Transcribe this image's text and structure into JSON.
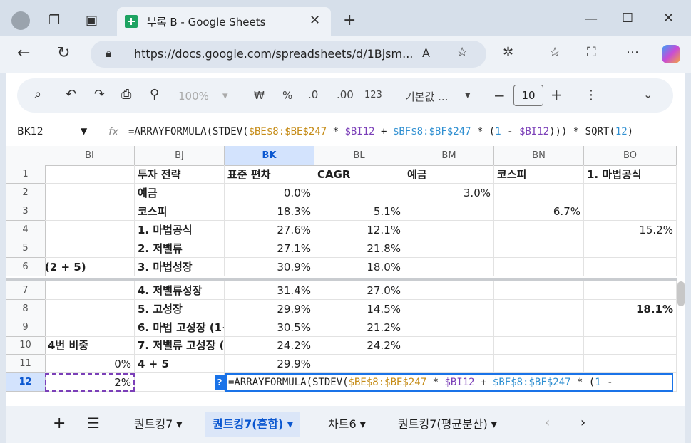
{
  "browser": {
    "tab_title": "부록 B - Google Sheets",
    "url": "https://docs.google.com/spreadsheets/d/1Bjsm..."
  },
  "toolbar": {
    "zoom": "100%",
    "currency": "₩",
    "percent": "%",
    "dec_decrease": ".0",
    "dec_increase": ".00",
    "format_123": "123",
    "font_name": "기본값 ...",
    "font_size": "10"
  },
  "formula_bar": {
    "name_box": "BK12",
    "fx": "fx",
    "formula_p1": "=ARRAYFORMULA(STDEV(",
    "formula_ref1": "$BE$8:$BE$247",
    "formula_p2": " * ",
    "formula_ref2": "$BI12",
    "formula_p3": " + ",
    "formula_ref3": "$BF$8:$BF$247",
    "formula_p4": " * (",
    "formula_num": "1",
    "formula_p5": " - ",
    "formula_ref4": "$BI12",
    "formula_p6": "))) * SQRT(",
    "formula_num2": "12",
    "formula_p7": ")"
  },
  "columns": [
    "BI",
    "BJ",
    "BK",
    "BL",
    "BM",
    "BN",
    "BO"
  ],
  "rows": [
    {
      "n": "1",
      "BI": "",
      "BJ": "투자 전략",
      "BK": "표준 편차",
      "BL": "CAGR",
      "BM": "예금",
      "BN": "코스피",
      "BO": "1. 마법공식"
    },
    {
      "n": "2",
      "BI": "",
      "BJ": "예금",
      "BK": "0.0%",
      "BL": "",
      "BM": "3.0%",
      "BN": "",
      "BO": ""
    },
    {
      "n": "3",
      "BI": "",
      "BJ": "코스피",
      "BK": "18.3%",
      "BL": "5.1%",
      "BM": "",
      "BN": "6.7%",
      "BO": ""
    },
    {
      "n": "4",
      "BI": "",
      "BJ": "1. 마법공식",
      "BK": "27.6%",
      "BL": "12.1%",
      "BM": "",
      "BN": "",
      "BO": "15.2%"
    },
    {
      "n": "5",
      "BI": "",
      "BJ": "2. 저밸류",
      "BK": "27.1%",
      "BL": "21.8%",
      "BM": "",
      "BN": "",
      "BO": ""
    },
    {
      "n": "6",
      "BI": "(2 + 5)",
      "BJ": "3. 마법성장",
      "BK": "30.9%",
      "BL": "18.0%",
      "BM": "",
      "BN": "",
      "BO": ""
    },
    {
      "n": "7",
      "BI": "",
      "BJ": "4. 저밸류성장",
      "BK": "31.4%",
      "BL": "27.0%",
      "BM": "",
      "BN": "",
      "BO": ""
    },
    {
      "n": "8",
      "BI": "",
      "BJ": "5. 고성장",
      "BK": "29.9%",
      "BL": "14.5%",
      "BM": "",
      "BN": "",
      "BO": "18.1%"
    },
    {
      "n": "9",
      "BI": "",
      "BJ": "6. 마법 고성장 (1+",
      "BK": "30.5%",
      "BL": "21.2%",
      "BM": "",
      "BN": "",
      "BO": ""
    },
    {
      "n": "10",
      "BI": "4번 비중",
      "BJ": "7. 저밸류 고성장 (",
      "BK": "24.2%",
      "BL": "24.2%",
      "BM": "",
      "BN": "",
      "BO": ""
    },
    {
      "n": "11",
      "BI": "0%",
      "BJ": "4 + 5",
      "BK": "29.9%",
      "BL": "",
      "BM": "",
      "BN": "",
      "BO": ""
    },
    {
      "n": "12",
      "BI": "2%",
      "BJ": "",
      "BK": "",
      "BL": "",
      "BM": "",
      "BN": "",
      "BO": ""
    }
  ],
  "editor": {
    "badge": "?",
    "p1": "=ARRAYFORMULA(STDEV(",
    "ref1": "$BE$8:$BE$247",
    "p2": " * ",
    "ref2": "$BI12",
    "p3": " + ",
    "ref3": "$BF$8:$BF$247",
    "p4": " * (",
    "num": "1",
    "p5": " -"
  },
  "sheet_tabs": [
    {
      "label": "퀀트킹7",
      "active": false
    },
    {
      "label": "퀀트킹7(혼합)",
      "active": true
    },
    {
      "label": "차트6",
      "active": false
    },
    {
      "label": "퀀트킹7(평균분산)",
      "active": false
    }
  ],
  "colors": {
    "accent": "#1a73e8",
    "active_tab": "#0b57d0",
    "selection_col": "#d3e3fd"
  }
}
